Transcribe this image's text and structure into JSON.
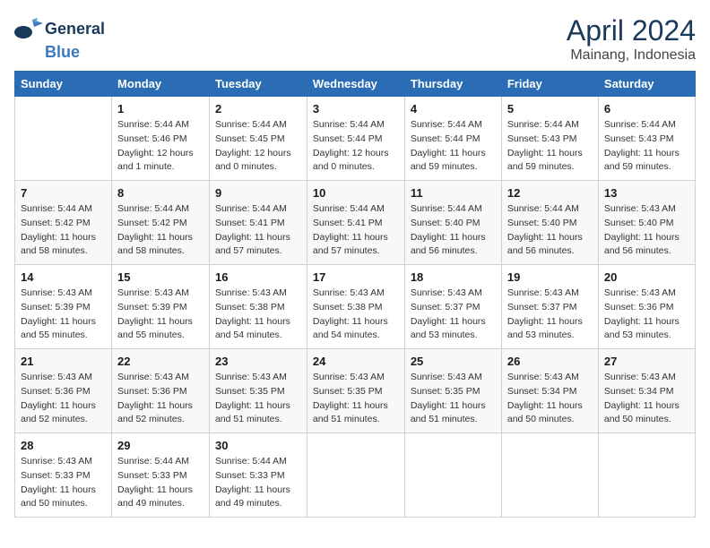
{
  "header": {
    "logo_line1": "General",
    "logo_line2": "Blue",
    "month": "April 2024",
    "location": "Mainang, Indonesia"
  },
  "weekdays": [
    "Sunday",
    "Monday",
    "Tuesday",
    "Wednesday",
    "Thursday",
    "Friday",
    "Saturday"
  ],
  "weeks": [
    [
      {
        "day": "",
        "detail": ""
      },
      {
        "day": "1",
        "detail": "Sunrise: 5:44 AM\nSunset: 5:46 PM\nDaylight: 12 hours\nand 1 minute."
      },
      {
        "day": "2",
        "detail": "Sunrise: 5:44 AM\nSunset: 5:45 PM\nDaylight: 12 hours\nand 0 minutes."
      },
      {
        "day": "3",
        "detail": "Sunrise: 5:44 AM\nSunset: 5:44 PM\nDaylight: 12 hours\nand 0 minutes."
      },
      {
        "day": "4",
        "detail": "Sunrise: 5:44 AM\nSunset: 5:44 PM\nDaylight: 11 hours\nand 59 minutes."
      },
      {
        "day": "5",
        "detail": "Sunrise: 5:44 AM\nSunset: 5:43 PM\nDaylight: 11 hours\nand 59 minutes."
      },
      {
        "day": "6",
        "detail": "Sunrise: 5:44 AM\nSunset: 5:43 PM\nDaylight: 11 hours\nand 59 minutes."
      }
    ],
    [
      {
        "day": "7",
        "detail": "Sunrise: 5:44 AM\nSunset: 5:42 PM\nDaylight: 11 hours\nand 58 minutes."
      },
      {
        "day": "8",
        "detail": "Sunrise: 5:44 AM\nSunset: 5:42 PM\nDaylight: 11 hours\nand 58 minutes."
      },
      {
        "day": "9",
        "detail": "Sunrise: 5:44 AM\nSunset: 5:41 PM\nDaylight: 11 hours\nand 57 minutes."
      },
      {
        "day": "10",
        "detail": "Sunrise: 5:44 AM\nSunset: 5:41 PM\nDaylight: 11 hours\nand 57 minutes."
      },
      {
        "day": "11",
        "detail": "Sunrise: 5:44 AM\nSunset: 5:40 PM\nDaylight: 11 hours\nand 56 minutes."
      },
      {
        "day": "12",
        "detail": "Sunrise: 5:44 AM\nSunset: 5:40 PM\nDaylight: 11 hours\nand 56 minutes."
      },
      {
        "day": "13",
        "detail": "Sunrise: 5:43 AM\nSunset: 5:40 PM\nDaylight: 11 hours\nand 56 minutes."
      }
    ],
    [
      {
        "day": "14",
        "detail": "Sunrise: 5:43 AM\nSunset: 5:39 PM\nDaylight: 11 hours\nand 55 minutes."
      },
      {
        "day": "15",
        "detail": "Sunrise: 5:43 AM\nSunset: 5:39 PM\nDaylight: 11 hours\nand 55 minutes."
      },
      {
        "day": "16",
        "detail": "Sunrise: 5:43 AM\nSunset: 5:38 PM\nDaylight: 11 hours\nand 54 minutes."
      },
      {
        "day": "17",
        "detail": "Sunrise: 5:43 AM\nSunset: 5:38 PM\nDaylight: 11 hours\nand 54 minutes."
      },
      {
        "day": "18",
        "detail": "Sunrise: 5:43 AM\nSunset: 5:37 PM\nDaylight: 11 hours\nand 53 minutes."
      },
      {
        "day": "19",
        "detail": "Sunrise: 5:43 AM\nSunset: 5:37 PM\nDaylight: 11 hours\nand 53 minutes."
      },
      {
        "day": "20",
        "detail": "Sunrise: 5:43 AM\nSunset: 5:36 PM\nDaylight: 11 hours\nand 53 minutes."
      }
    ],
    [
      {
        "day": "21",
        "detail": "Sunrise: 5:43 AM\nSunset: 5:36 PM\nDaylight: 11 hours\nand 52 minutes."
      },
      {
        "day": "22",
        "detail": "Sunrise: 5:43 AM\nSunset: 5:36 PM\nDaylight: 11 hours\nand 52 minutes."
      },
      {
        "day": "23",
        "detail": "Sunrise: 5:43 AM\nSunset: 5:35 PM\nDaylight: 11 hours\nand 51 minutes."
      },
      {
        "day": "24",
        "detail": "Sunrise: 5:43 AM\nSunset: 5:35 PM\nDaylight: 11 hours\nand 51 minutes."
      },
      {
        "day": "25",
        "detail": "Sunrise: 5:43 AM\nSunset: 5:35 PM\nDaylight: 11 hours\nand 51 minutes."
      },
      {
        "day": "26",
        "detail": "Sunrise: 5:43 AM\nSunset: 5:34 PM\nDaylight: 11 hours\nand 50 minutes."
      },
      {
        "day": "27",
        "detail": "Sunrise: 5:43 AM\nSunset: 5:34 PM\nDaylight: 11 hours\nand 50 minutes."
      }
    ],
    [
      {
        "day": "28",
        "detail": "Sunrise: 5:43 AM\nSunset: 5:33 PM\nDaylight: 11 hours\nand 50 minutes."
      },
      {
        "day": "29",
        "detail": "Sunrise: 5:44 AM\nSunset: 5:33 PM\nDaylight: 11 hours\nand 49 minutes."
      },
      {
        "day": "30",
        "detail": "Sunrise: 5:44 AM\nSunset: 5:33 PM\nDaylight: 11 hours\nand 49 minutes."
      },
      {
        "day": "",
        "detail": ""
      },
      {
        "day": "",
        "detail": ""
      },
      {
        "day": "",
        "detail": ""
      },
      {
        "day": "",
        "detail": ""
      }
    ]
  ]
}
